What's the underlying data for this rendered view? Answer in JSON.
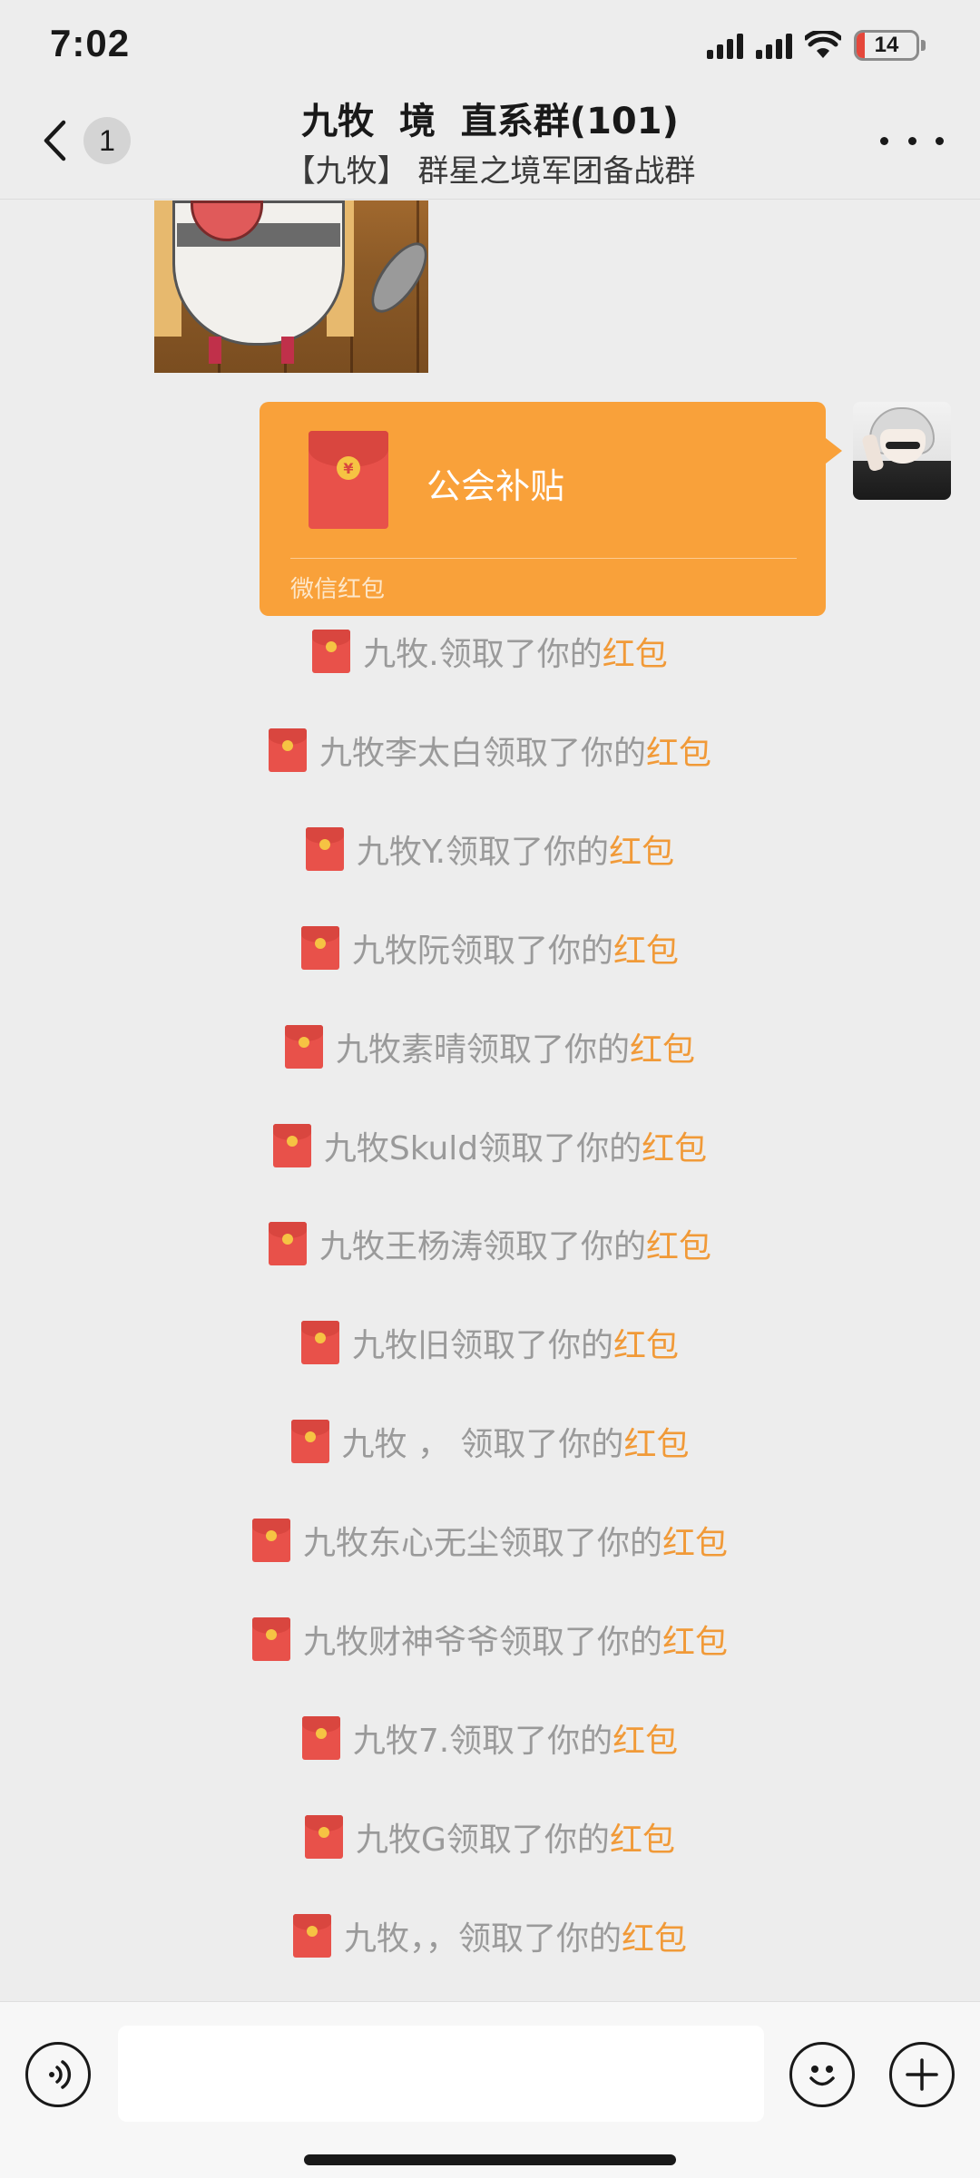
{
  "status_bar": {
    "time": "7:02",
    "battery_level": "14",
    "battery_color": "#e5473b",
    "icons": [
      "signal-icon",
      "signal-icon",
      "wifi-icon",
      "battery-icon"
    ]
  },
  "nav": {
    "back_badge": "1",
    "title": "九牧  境  直系群(101)",
    "subtitle": "【九牧】 群星之境军团备战群"
  },
  "messages": {
    "red_packet": {
      "title": "公会补贴",
      "footer": "微信红包",
      "color": "#f9a13a",
      "coin_symbol": "¥"
    },
    "notices": [
      {
        "prefix": "九牧.领取了你的",
        "link": "红包"
      },
      {
        "prefix": "九牧李太白领取了你的",
        "link": "红包"
      },
      {
        "prefix": "九牧Y.领取了你的",
        "link": "红包"
      },
      {
        "prefix": "九牧阮领取了你的",
        "link": "红包"
      },
      {
        "prefix": "九牧素晴领取了你的",
        "link": "红包"
      },
      {
        "prefix": "九牧Skuld领取了你的",
        "link": "红包"
      },
      {
        "prefix": "九牧王杨涛领取了你的",
        "link": "红包"
      },
      {
        "prefix": "九牧旧领取了你的",
        "link": "红包"
      },
      {
        "prefix": "九牧 ， 领取了你的",
        "link": "红包"
      },
      {
        "prefix": "九牧东心无尘领取了你的",
        "link": "红包"
      },
      {
        "prefix": "九牧财神爷爷领取了你的",
        "link": "红包"
      },
      {
        "prefix": "九牧7.领取了你的",
        "link": "红包"
      },
      {
        "prefix": "九牧G领取了你的",
        "link": "红包"
      },
      {
        "prefix": "九牧，，领取了你的",
        "link": "红包"
      }
    ]
  },
  "input_bar": {
    "text_value": "",
    "icons": [
      "voice-icon",
      "emoji-icon",
      "plus-icon"
    ]
  }
}
